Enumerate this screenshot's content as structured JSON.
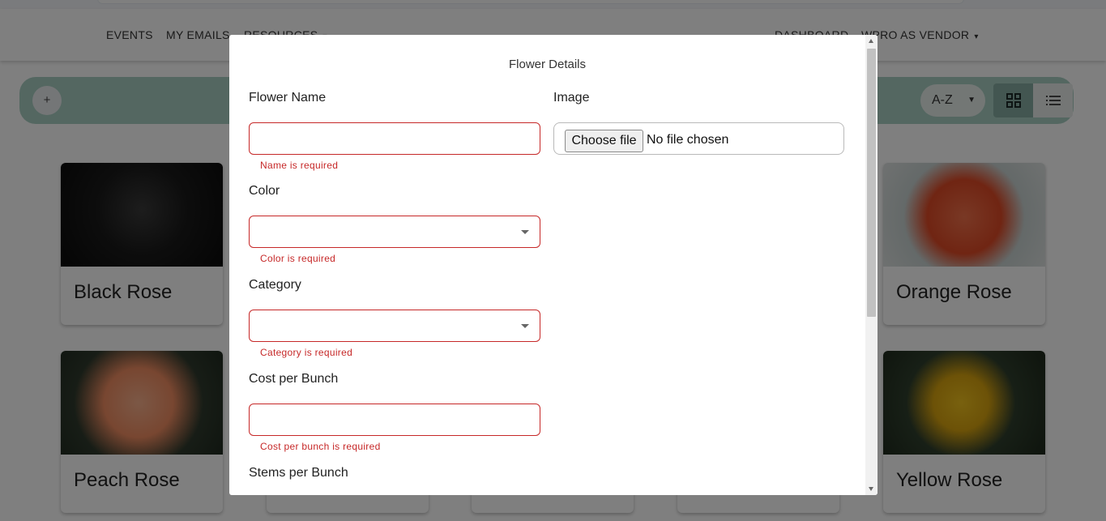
{
  "nav": {
    "left": [
      "EVENTS",
      "MY EMAILS",
      "RESOURCES"
    ],
    "right": [
      "DASHBOARD",
      "WPRO AS VENDOR"
    ]
  },
  "toolbar": {
    "add_label": "+",
    "sort_value": "A-Z",
    "view_modes": [
      "grid",
      "list"
    ],
    "active_view": "grid",
    "accent_color": "#a9cfc3"
  },
  "cards": [
    {
      "name": "Black Rose",
      "color": "#1c1c1c"
    },
    {
      "name": "Orange Rose",
      "color": "#e2532f"
    },
    {
      "name": "Peach Rose",
      "color": "#f29a73"
    },
    {
      "name": "Yellow Rose",
      "color": "#e6b41a"
    }
  ],
  "modal": {
    "title": "Flower Details",
    "fields": {
      "name": {
        "label": "Flower Name",
        "value": "",
        "error": "Name is required"
      },
      "color": {
        "label": "Color",
        "value": "",
        "error": "Color is required"
      },
      "category": {
        "label": "Category",
        "value": "",
        "error": "Category is required"
      },
      "cost": {
        "label": "Cost per Bunch",
        "value": "",
        "error": "Cost per bunch is required"
      },
      "stems": {
        "label": "Stems per Bunch"
      },
      "image": {
        "label": "Image",
        "button": "Choose file",
        "status": "No file chosen"
      }
    },
    "error_color": "#c62828"
  }
}
